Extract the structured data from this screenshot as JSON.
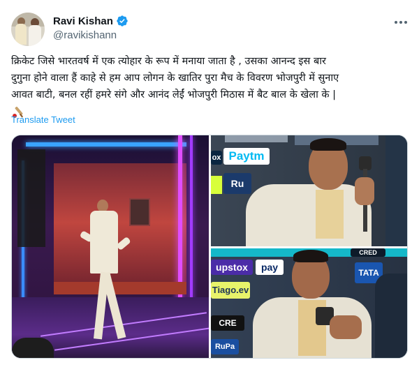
{
  "author": {
    "name": "Ravi Kishan",
    "handle": "@ravikishann",
    "verified_icon": "verified-badge-icon",
    "avatar": "avatar"
  },
  "menu_icon": "more-options-icon",
  "tweet": {
    "line1": "क्रिकेट जिसे भारतवर्ष में एक त्योहार के रूप में मनाया जाता है , उसका आनन्द इस बार",
    "line2": "दुगुना होने वाला हैं काहे से हम आप लोगन के खातिर पुरा मैच के विवरण भोजपुरी में सुनाए",
    "line3": "आवत बाटी, बनल रहीं हमरे संगे और आनंद लेईं भोजपुरी मिठास में बैट बाल के खेला के |",
    "emoji": "cricket-bat-ball-icon"
  },
  "translate_label": "Translate Tweet",
  "media": {
    "sponsors_top": [
      "Paytm",
      "Ru",
      "ox"
    ],
    "sponsors_bottom": [
      "upstox",
      "pay",
      "Tiago.ev",
      "CRE",
      "RuPa",
      "TATA",
      "CRED"
    ]
  },
  "colors": {
    "link": "#1d9bf0",
    "secondary_text": "#536471",
    "verified": "#1d9bf0"
  }
}
